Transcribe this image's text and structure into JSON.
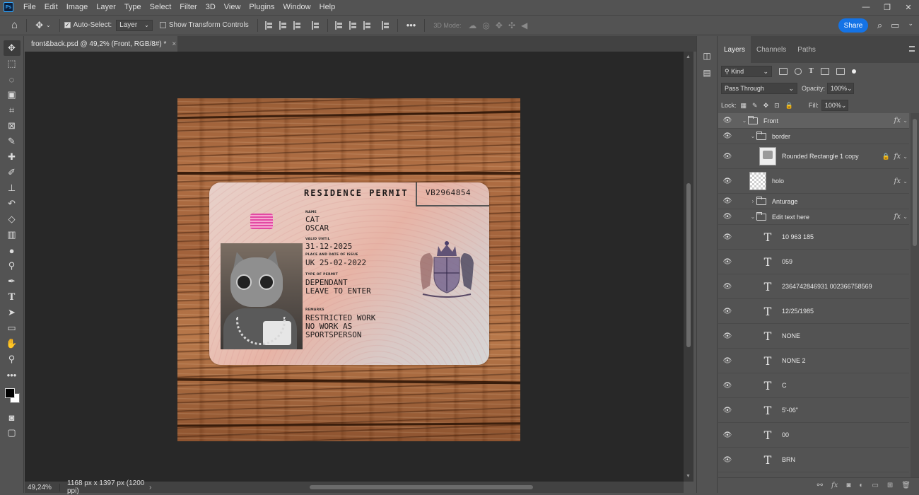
{
  "menu": [
    "File",
    "Edit",
    "Image",
    "Layer",
    "Type",
    "Select",
    "Filter",
    "3D",
    "View",
    "Plugins",
    "Window",
    "Help"
  ],
  "app_logo": "Ps",
  "options": {
    "auto_select_label": "Auto-Select:",
    "auto_select_value": "Layer",
    "transform_label": "Show Transform Controls",
    "mode_3d_label": "3D Mode:",
    "share_label": "Share"
  },
  "document_tab": {
    "title": "front&back.psd @ 49,2% (Front, RGB/8#) *",
    "close": "×"
  },
  "status": {
    "zoom": "49,24%",
    "dims": "1168 px x 1397 px (1200 ppi)"
  },
  "card": {
    "title": "RESIDENCE PERMIT",
    "number": "VB2964854",
    "name_label": "NAME",
    "name_line1": "CAT",
    "name_line2": "OSCAR",
    "valid_label": "VALID UNTIL",
    "valid_value": "31-12-2025",
    "issue_label": "PLACE AND DATE OF ISSUE",
    "issue_value": "UK 25-02-2022",
    "type_label": "TYPE OF PERMIT",
    "type_line1": "DEPENDANT",
    "type_line2": "LEAVE TO ENTER",
    "remarks_label": "REMARKS",
    "remarks_line1": "RESTRICTED WORK",
    "remarks_line2": "NO WORK AS",
    "remarks_line3": "SPORTSPERSON"
  },
  "panels": {
    "tabs": [
      "Layers",
      "Channels",
      "Paths"
    ],
    "filter_kind": "Kind",
    "blend_mode": "Pass Through",
    "opacity_label": "Opacity:",
    "opacity_value": "100%",
    "lock_label": "Lock:",
    "fill_label": "Fill:",
    "fill_value": "100%"
  },
  "layers": [
    {
      "name": "Front"
    },
    {
      "name": "border"
    },
    {
      "name": "Rounded Rectangle 1 copy"
    },
    {
      "name": "holo"
    },
    {
      "name": "Anturage"
    },
    {
      "name": "Edit text here"
    },
    {
      "name": "10 963 185"
    },
    {
      "name": "059"
    },
    {
      "name": "2364742846931 002366758569"
    },
    {
      "name": "12/25/1985"
    },
    {
      "name": "NONE"
    },
    {
      "name": "NONE 2"
    },
    {
      "name": "C"
    },
    {
      "name": "5'-06\""
    },
    {
      "name": "00"
    },
    {
      "name": "BRN"
    }
  ],
  "colors": {
    "accent": "#1473e6",
    "canvas_bg": "#282828",
    "ui_bg": "#535353"
  }
}
